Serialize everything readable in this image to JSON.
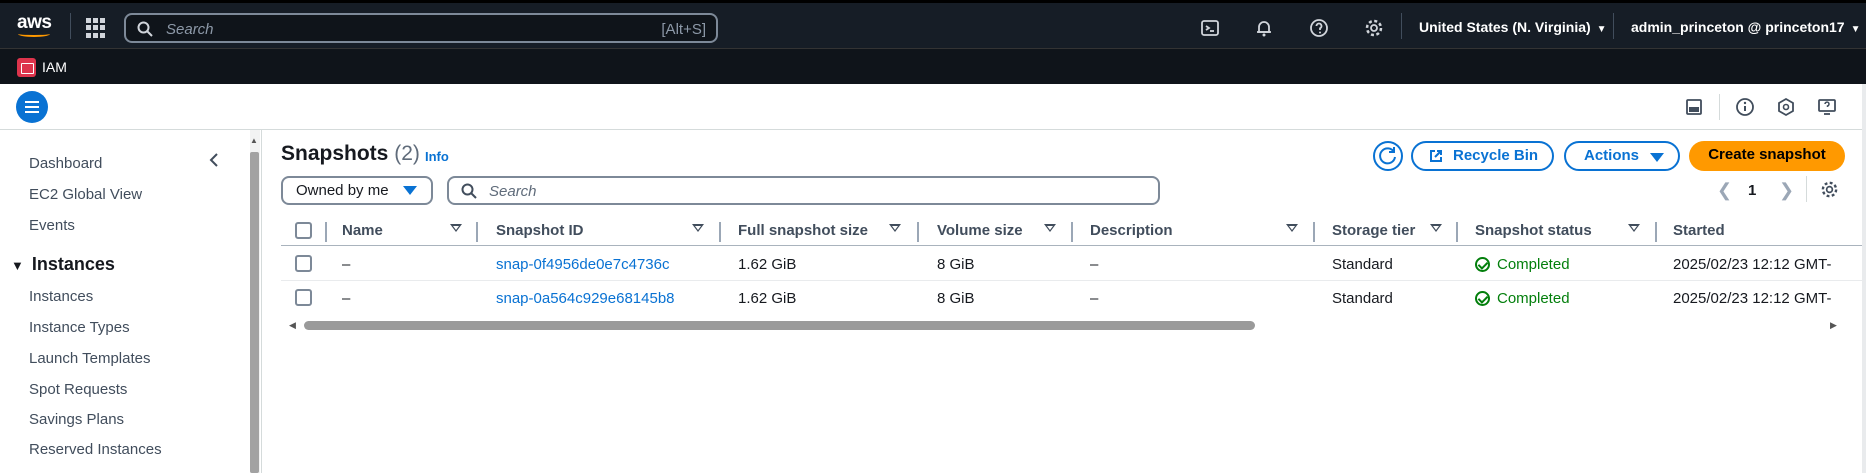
{
  "topnav": {
    "logo": "aws",
    "search_placeholder": "Search",
    "search_shortcut": "[Alt+S]",
    "region": "United States (N. Virginia)",
    "account": "admin_princeton @ princeton17",
    "icons": [
      "cloudshell-icon",
      "bell-icon",
      "help-icon",
      "gear-icon"
    ]
  },
  "servicebar": {
    "service": "IAM",
    "badge_color": "#dd344c"
  },
  "sidebar": {
    "top_items": [
      {
        "label": "Dashboard"
      },
      {
        "label": "EC2 Global View"
      },
      {
        "label": "Events"
      }
    ],
    "section": "Instances",
    "section_items": [
      {
        "label": "Instances"
      },
      {
        "label": "Instance Types"
      },
      {
        "label": "Launch Templates"
      },
      {
        "label": "Spot Requests"
      },
      {
        "label": "Savings Plans"
      },
      {
        "label": "Reserved Instances"
      }
    ]
  },
  "header": {
    "title": "Snapshots",
    "count": "(2)",
    "info": "Info",
    "recycle_bin": "Recycle Bin",
    "actions": "Actions",
    "create": "Create snapshot"
  },
  "filter": {
    "owned_by": "Owned by me",
    "search_placeholder": "Search",
    "page": "1"
  },
  "table": {
    "columns": [
      "Name",
      "Snapshot ID",
      "Full snapshot size",
      "Volume size",
      "Description",
      "Storage tier",
      "Snapshot status",
      "Started"
    ],
    "rows": [
      {
        "name": "–",
        "snapshot_id": "snap-0f4956de0e7c4736c",
        "full_size": "1.62 GiB",
        "volume_size": "8 GiB",
        "description": "–",
        "storage_tier": "Standard",
        "status": "Completed",
        "started": "2025/02/23 12:12 GMT-"
      },
      {
        "name": "–",
        "snapshot_id": "snap-0a564c929e68145b8",
        "full_size": "1.62 GiB",
        "volume_size": "8 GiB",
        "description": "–",
        "storage_tier": "Standard",
        "status": "Completed",
        "started": "2025/02/23 12:12 GMT-"
      }
    ]
  },
  "colors": {
    "accent": "#0972d3",
    "primary_button": "#ff9900",
    "success": "#037f0c",
    "nav_bg": "#161d26"
  }
}
